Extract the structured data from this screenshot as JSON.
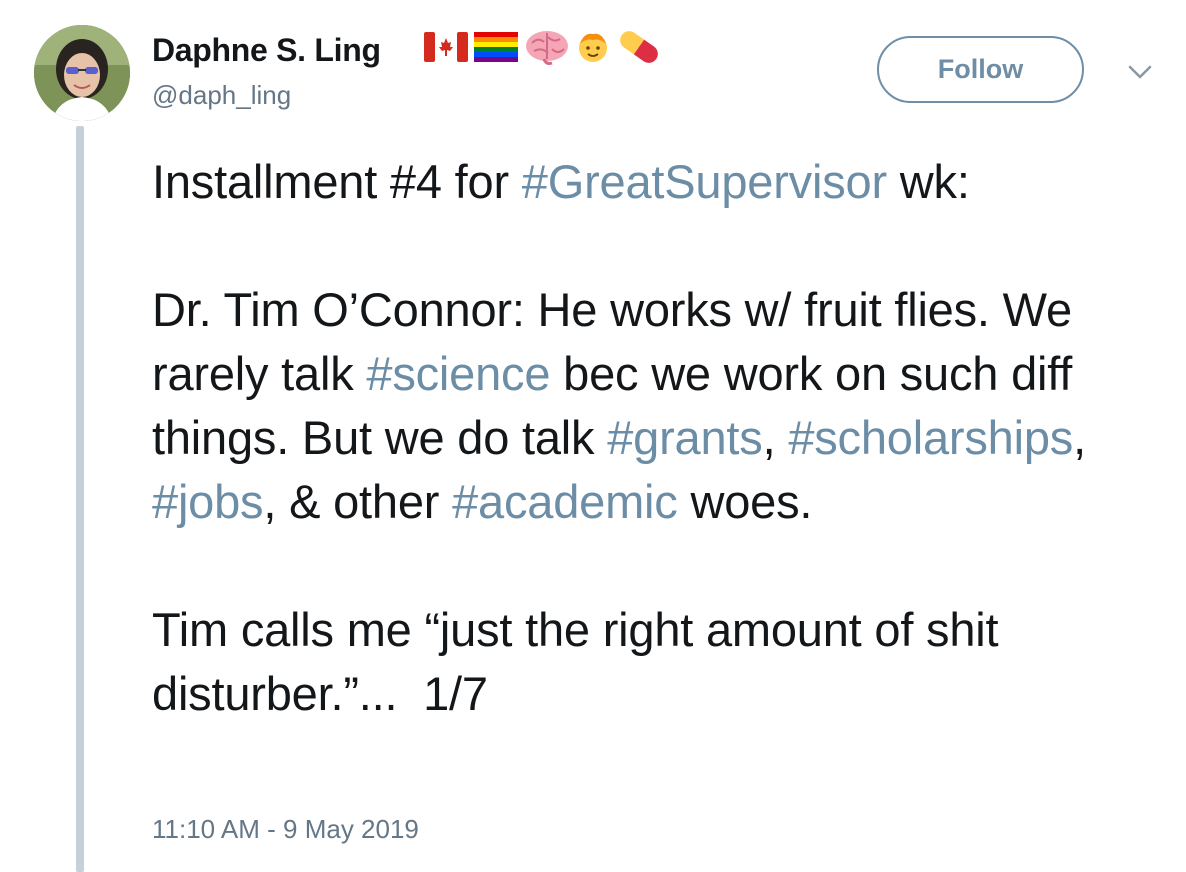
{
  "tweet": {
    "author": {
      "display_name": "Daphne S. Ling",
      "handle": "@daph_ling",
      "name_emojis": [
        "canada-flag-icon",
        "rainbow-flag-icon",
        "brain-icon",
        "child-face-icon",
        "pill-icon"
      ]
    },
    "follow_label": "Follow",
    "body": {
      "line1": {
        "t1": "Installment #4 for ",
        "h1": "#GreatSupervisor",
        "t2": " wk:"
      },
      "para2": {
        "t1": "Dr. Tim O’Connor: He works w/ fruit flies. We rarely talk ",
        "h1": "#science",
        "t2": " bec we work on such diff things. But we do talk ",
        "h2": "#grants",
        "t3": ", ",
        "h3": "#scholarships",
        "t4": ", ",
        "h4": "#jobs",
        "t5": ", & other ",
        "h5": "#academic",
        "t6": " woes."
      },
      "para3": {
        "t1": "Tim calls me “just the right amount of shit disturber.”...  1/7"
      }
    },
    "timestamp": "11:10 AM - 9 May 2019"
  },
  "colors": {
    "hashtag": "#6c8da6",
    "text": "#14171a",
    "secondary": "#657786",
    "thread_line": "#c4d1db"
  }
}
